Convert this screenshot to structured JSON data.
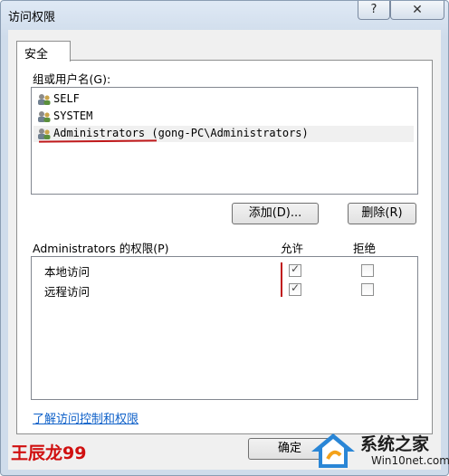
{
  "window": {
    "title": "访问权限",
    "help_label": "?",
    "close_label": "✕"
  },
  "tabs": [
    {
      "label": "安全"
    }
  ],
  "groups": {
    "label": "组或用户名(G):",
    "users": [
      {
        "name": "SELF",
        "icon": "users-icon"
      },
      {
        "name": "SYSTEM",
        "icon": "users-icon"
      },
      {
        "name": "Administrators (gong-PC\\Administrators)",
        "icon": "users-icon"
      }
    ],
    "add_label": "添加(D)...",
    "remove_label": "删除(R)"
  },
  "permissions": {
    "label": "Administrators 的权限(P)",
    "allow_header": "允许",
    "deny_header": "拒绝",
    "rows": [
      {
        "name": "本地访问",
        "allow": true,
        "deny": false
      },
      {
        "name": "远程访问",
        "allow": true,
        "deny": false
      }
    ]
  },
  "link_label": "了解访问控制和权限",
  "ok_label": "确定",
  "watermark": "王辰龙99",
  "logo": {
    "title": "系统之家",
    "url": "Win10net.com"
  },
  "colors": {
    "annotation_red": "#c0181a",
    "link_blue": "#0f61c9"
  }
}
